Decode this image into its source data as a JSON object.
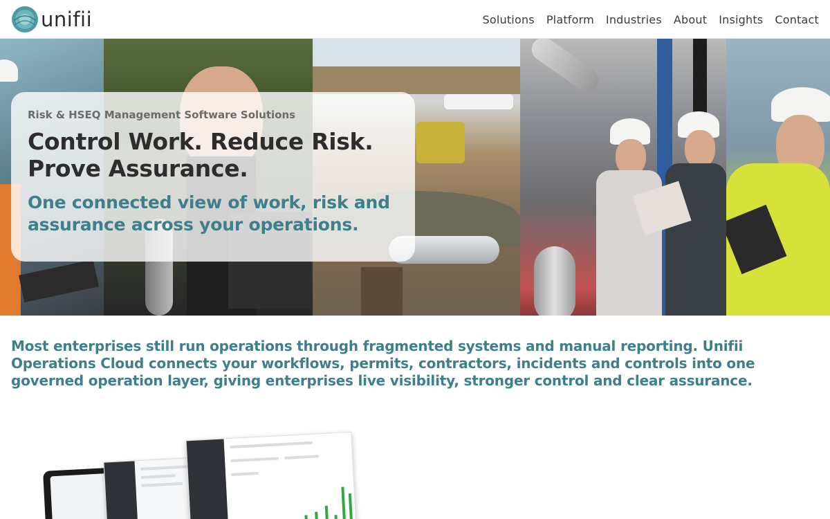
{
  "header": {
    "logo_text": "unifii",
    "logo_icon": "unifii-logo-mark",
    "nav": [
      {
        "label": "Solutions"
      },
      {
        "label": "Platform"
      },
      {
        "label": "Industries"
      },
      {
        "label": "About"
      },
      {
        "label": "Insights"
      },
      {
        "label": "Contact"
      }
    ]
  },
  "hero": {
    "eyebrow": "Risk & HSEQ Management Software Solutions",
    "headline": "Control Work. Reduce Risk. Prove Assurance.",
    "subhead": "One connected view of work, risk and assurance across your operations."
  },
  "intro": {
    "text": "Most enterprises still run operations through fragmented systems and manual reporting. Unifii Operations Cloud connects your workflows, permits, contractors, incidents and controls into one governed operation layer, giving enterprises live visibility, stronger control and clear assurance."
  },
  "colors": {
    "accent": "#3f7f8b",
    "headline": "#2d2d2d",
    "nav_text": "#3a3a3a"
  }
}
